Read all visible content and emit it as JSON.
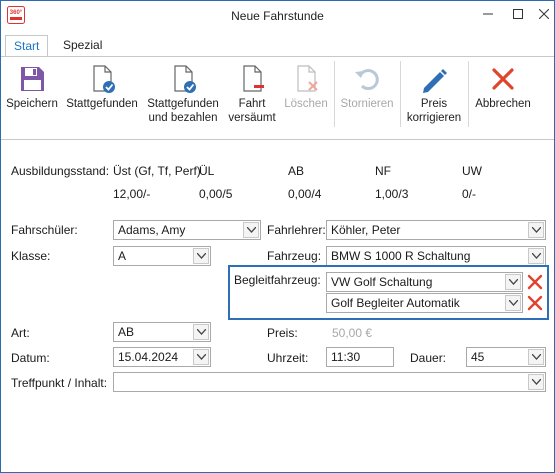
{
  "window": {
    "title": "Neue Fahrstunde",
    "logo_text": "360°"
  },
  "tabs": [
    {
      "label": "Start",
      "active": true
    },
    {
      "label": "Spezial",
      "active": false
    }
  ],
  "ribbon": {
    "save": "Speichern",
    "done": "Stattgefunden",
    "done_paid_1": "Stattgefunden",
    "done_paid_2": "und bezahlen",
    "missed_1": "Fahrt",
    "missed_2": "versäumt",
    "delete": "Löschen",
    "cancel_booking": "Stornieren",
    "price_1": "Preis",
    "price_2": "korrigieren",
    "abort": "Abbrechen"
  },
  "status": {
    "label": "Ausbildungsstand:",
    "headers": [
      "Üst (Gf, Tf, Perf)",
      "ÜL",
      "AB",
      "NF",
      "UW"
    ],
    "values": [
      "12,00/-",
      "0,00/5",
      "0,00/4",
      "1,00/3",
      "0/-"
    ]
  },
  "form": {
    "student_label": "Fahrschüler:",
    "student_value": "Adams, Amy",
    "instructor_label": "Fahrlehrer:",
    "instructor_value": "Köhler, Peter",
    "class_label": "Klasse:",
    "class_value": "A",
    "vehicle_label": "Fahrzeug:",
    "vehicle_value": "BMW S 1000 R Schaltung",
    "escort_label": "Begleitfahrzeug:",
    "escort_values": [
      "VW Golf Schaltung",
      "Golf Begleiter  Automatik"
    ],
    "type_label": "Art:",
    "type_value": "AB",
    "price_label": "Preis:",
    "price_value": "50,00 €",
    "date_label": "Datum:",
    "date_value": "15.04.2024",
    "time_label": "Uhrzeit:",
    "time_value": "11:30",
    "duration_label": "Dauer:",
    "duration_value": "45",
    "meeting_label": "Treffpunkt / Inhalt:",
    "meeting_value": ""
  },
  "colors": {
    "accent": "#1a73c8",
    "frame": "#2e6fb5",
    "delete_red": "#e0442c",
    "disabled": "#a8a8a8"
  }
}
